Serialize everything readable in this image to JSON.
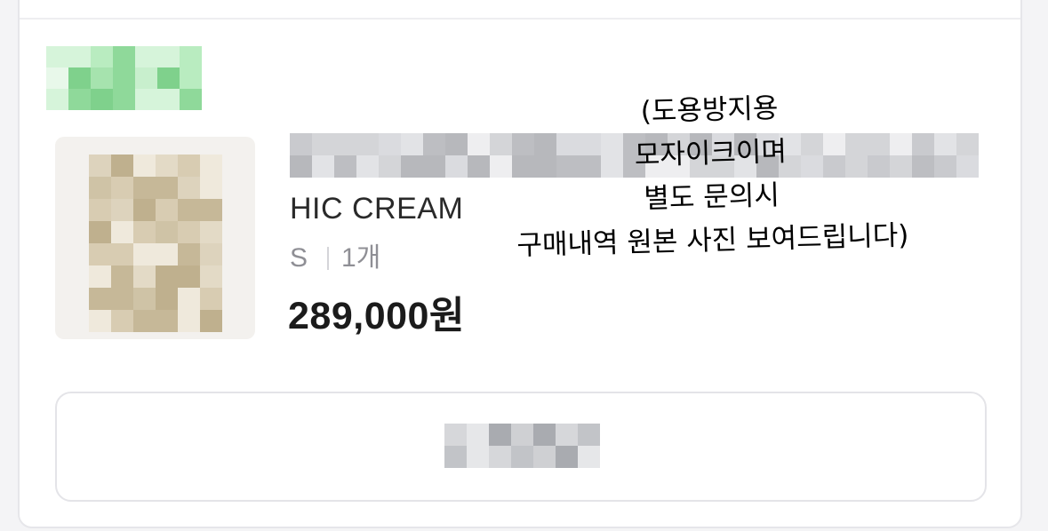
{
  "order_item": {
    "product_name": "HIC CREAM",
    "option_size": "S",
    "option_quantity": "1개",
    "price": "289,000원"
  },
  "annotation": {
    "lines": [
      "(도용방지용",
      "모자이크이며",
      "별도 문의시",
      "구매내역 원본 사진 보여드립니다)"
    ]
  },
  "colors": {
    "status_green": "#8fd99a",
    "thumbnail_beige": "#cfc3a6",
    "mosaic_gray": "#c9cace",
    "price_text": "#1b1b1b",
    "option_text": "#8f8f95"
  }
}
